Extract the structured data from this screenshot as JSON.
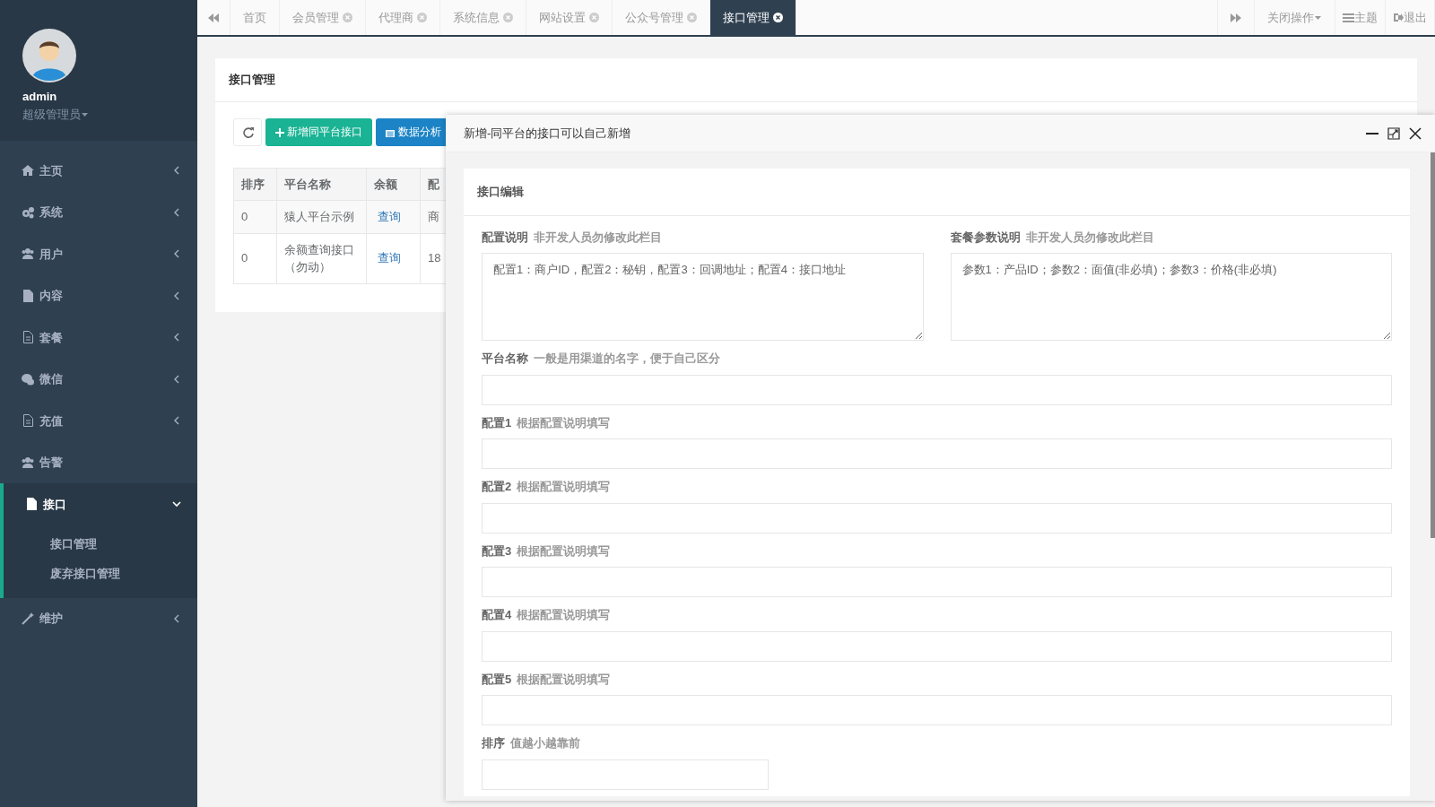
{
  "user": {
    "name": "admin",
    "role": "超级管理员"
  },
  "sidebar": {
    "items": [
      {
        "label": "主页",
        "expanded": false,
        "has_arrow": true
      },
      {
        "label": "系统",
        "expanded": false,
        "has_arrow": true
      },
      {
        "label": "用户",
        "expanded": false,
        "has_arrow": true
      },
      {
        "label": "内容",
        "expanded": false,
        "has_arrow": true
      },
      {
        "label": "套餐",
        "expanded": false,
        "has_arrow": true
      },
      {
        "label": "微信",
        "expanded": false,
        "has_arrow": true
      },
      {
        "label": "充值",
        "expanded": false,
        "has_arrow": true
      },
      {
        "label": "告警",
        "expanded": false,
        "has_arrow": false
      },
      {
        "label": "接口",
        "expanded": true,
        "has_arrow": true,
        "children": [
          {
            "label": "接口管理"
          },
          {
            "label": "废弃接口管理"
          }
        ]
      },
      {
        "label": "维护",
        "expanded": false,
        "has_arrow": true
      }
    ]
  },
  "tabs": [
    {
      "label": "首页",
      "closable": false,
      "selected": false
    },
    {
      "label": "会员管理",
      "closable": true,
      "selected": false
    },
    {
      "label": "代理商",
      "closable": true,
      "selected": false
    },
    {
      "label": "系统信息",
      "closable": true,
      "selected": false
    },
    {
      "label": "网站设置",
      "closable": true,
      "selected": false
    },
    {
      "label": "公众号管理",
      "closable": true,
      "selected": false
    },
    {
      "label": "接口管理",
      "closable": true,
      "selected": true
    }
  ],
  "toolbar": {
    "close_menu": "关闭操作",
    "theme": "主题",
    "logout": "退出"
  },
  "panel": {
    "title": "接口管理",
    "buttons": [
      {
        "label": "新增同平台接口",
        "kind": "add"
      },
      {
        "label": "数据分析",
        "kind": "chart"
      }
    ],
    "table": {
      "columns": [
        "排序",
        "平台名称",
        "余额",
        "配"
      ],
      "rows": [
        [
          "0",
          "猿人平台示例",
          "查询",
          "商"
        ],
        [
          "0",
          "余额查询接口（勿动）",
          "查询",
          "18"
        ]
      ]
    }
  },
  "dialog": {
    "title": "新增-同平台的接口可以自己新增",
    "card_title": "接口编辑",
    "notes": [
      {
        "label": "配置说明",
        "hint": "非开发人员勿修改此栏目",
        "value": "配置1：商户ID，配置2：秘钥，配置3：回调地址；配置4：接口地址"
      },
      {
        "label": "套餐参数说明",
        "hint": "非开发人员勿修改此栏目",
        "value": "参数1：产品ID；参数2：面值(非必填)；参数3：价格(非必填)"
      }
    ],
    "fields": [
      {
        "label": "平台名称",
        "hint": "一般是用渠道的名字，便于自己区分",
        "kind": "wide"
      },
      {
        "label": "配置1",
        "hint": "根据配置说明填写",
        "kind": "wide"
      },
      {
        "label": "配置2",
        "hint": "根据配置说明填写",
        "kind": "wide"
      },
      {
        "label": "配置3",
        "hint": "根据配置说明填写",
        "kind": "wide"
      },
      {
        "label": "配置4",
        "hint": "根据配置说明填写",
        "kind": "wide"
      },
      {
        "label": "配置5",
        "hint": "根据配置说明填写",
        "kind": "wide"
      },
      {
        "label": "排序",
        "hint": "值越小越靠前",
        "kind": "short"
      }
    ]
  }
}
